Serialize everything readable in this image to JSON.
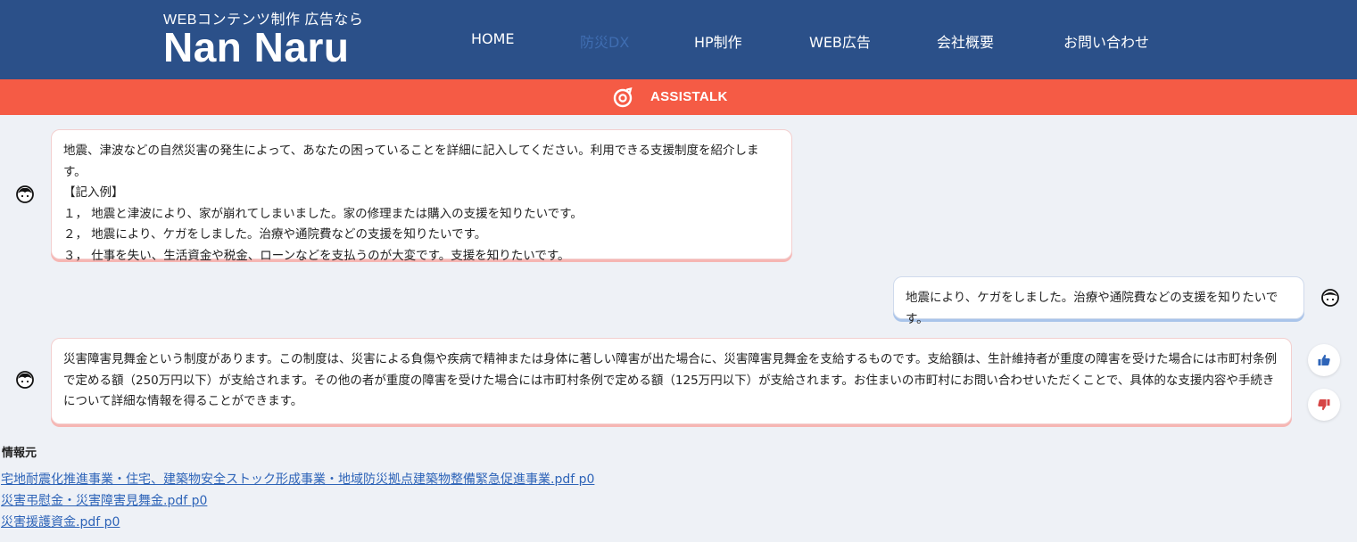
{
  "header": {
    "logo_sub": "WEBコンテンツ制作 広告なら",
    "logo_main": "Nan Naru",
    "nav": [
      {
        "label": "HOME",
        "active": false
      },
      {
        "label": "防災DX",
        "active": true
      },
      {
        "label": "HP制作",
        "active": false
      },
      {
        "label": "WEB広告",
        "active": false
      },
      {
        "label": "会社概要",
        "active": false
      },
      {
        "label": "お問い合わせ",
        "active": false
      }
    ]
  },
  "brand": {
    "name": "ASSISTALK",
    "icon": "chat-ring-icon",
    "color": "#f55b45"
  },
  "chat": {
    "messages": [
      {
        "role": "bot",
        "text": "地震、津波などの自然災害の発生によって、あなたの困っていることを詳細に記入してください。利用できる支援制度を紹介します。\n【記入例】\n１， 地震と津波により、家が崩れてしまいました。家の修理または購入の支援を知りたいです。\n２， 地震により、ケガをしました。治療や通院費などの支援を知りたいです。\n３， 仕事を失い、生活資金や税金、ローンなどを支払うのが大変です。支援を知りたいです。"
      },
      {
        "role": "user",
        "text": "地震により、ケガをしました。治療や通院費などの支援を知りたいです。"
      },
      {
        "role": "bot",
        "text": "災害障害見舞金という制度があります。この制度は、災害による負傷や疾病で精神または身体に著しい障害が出た場合に、災害障害見舞金を支給するものです。支給額は、生計維持者が重度の障害を受けた場合には市町村条例で定める額（250万円以下）が支給されます。その他の者が重度の障害を受けた場合には市町村条例で定める額（125万円以下）が支給されます。お住まいの市町村にお問い合わせいただくことで、具体的な支援内容や手続きについて詳細な情報を得ることができます。"
      }
    ]
  },
  "feedback": {
    "thumbs_up_icon": "thumbs-up-icon",
    "thumbs_down_icon": "thumbs-down-icon",
    "up_color": "#2e64b8",
    "down_color": "#d64545"
  },
  "sources": {
    "title": "情報元",
    "links": [
      "宅地耐震化推進事業・住宅、建築物安全ストック形成事業・地域防災拠点建築物整備緊急促進事業.pdf p0",
      "災害弔慰金・災害障害見舞金.pdf p0",
      "災害援護資金.pdf p0"
    ]
  }
}
